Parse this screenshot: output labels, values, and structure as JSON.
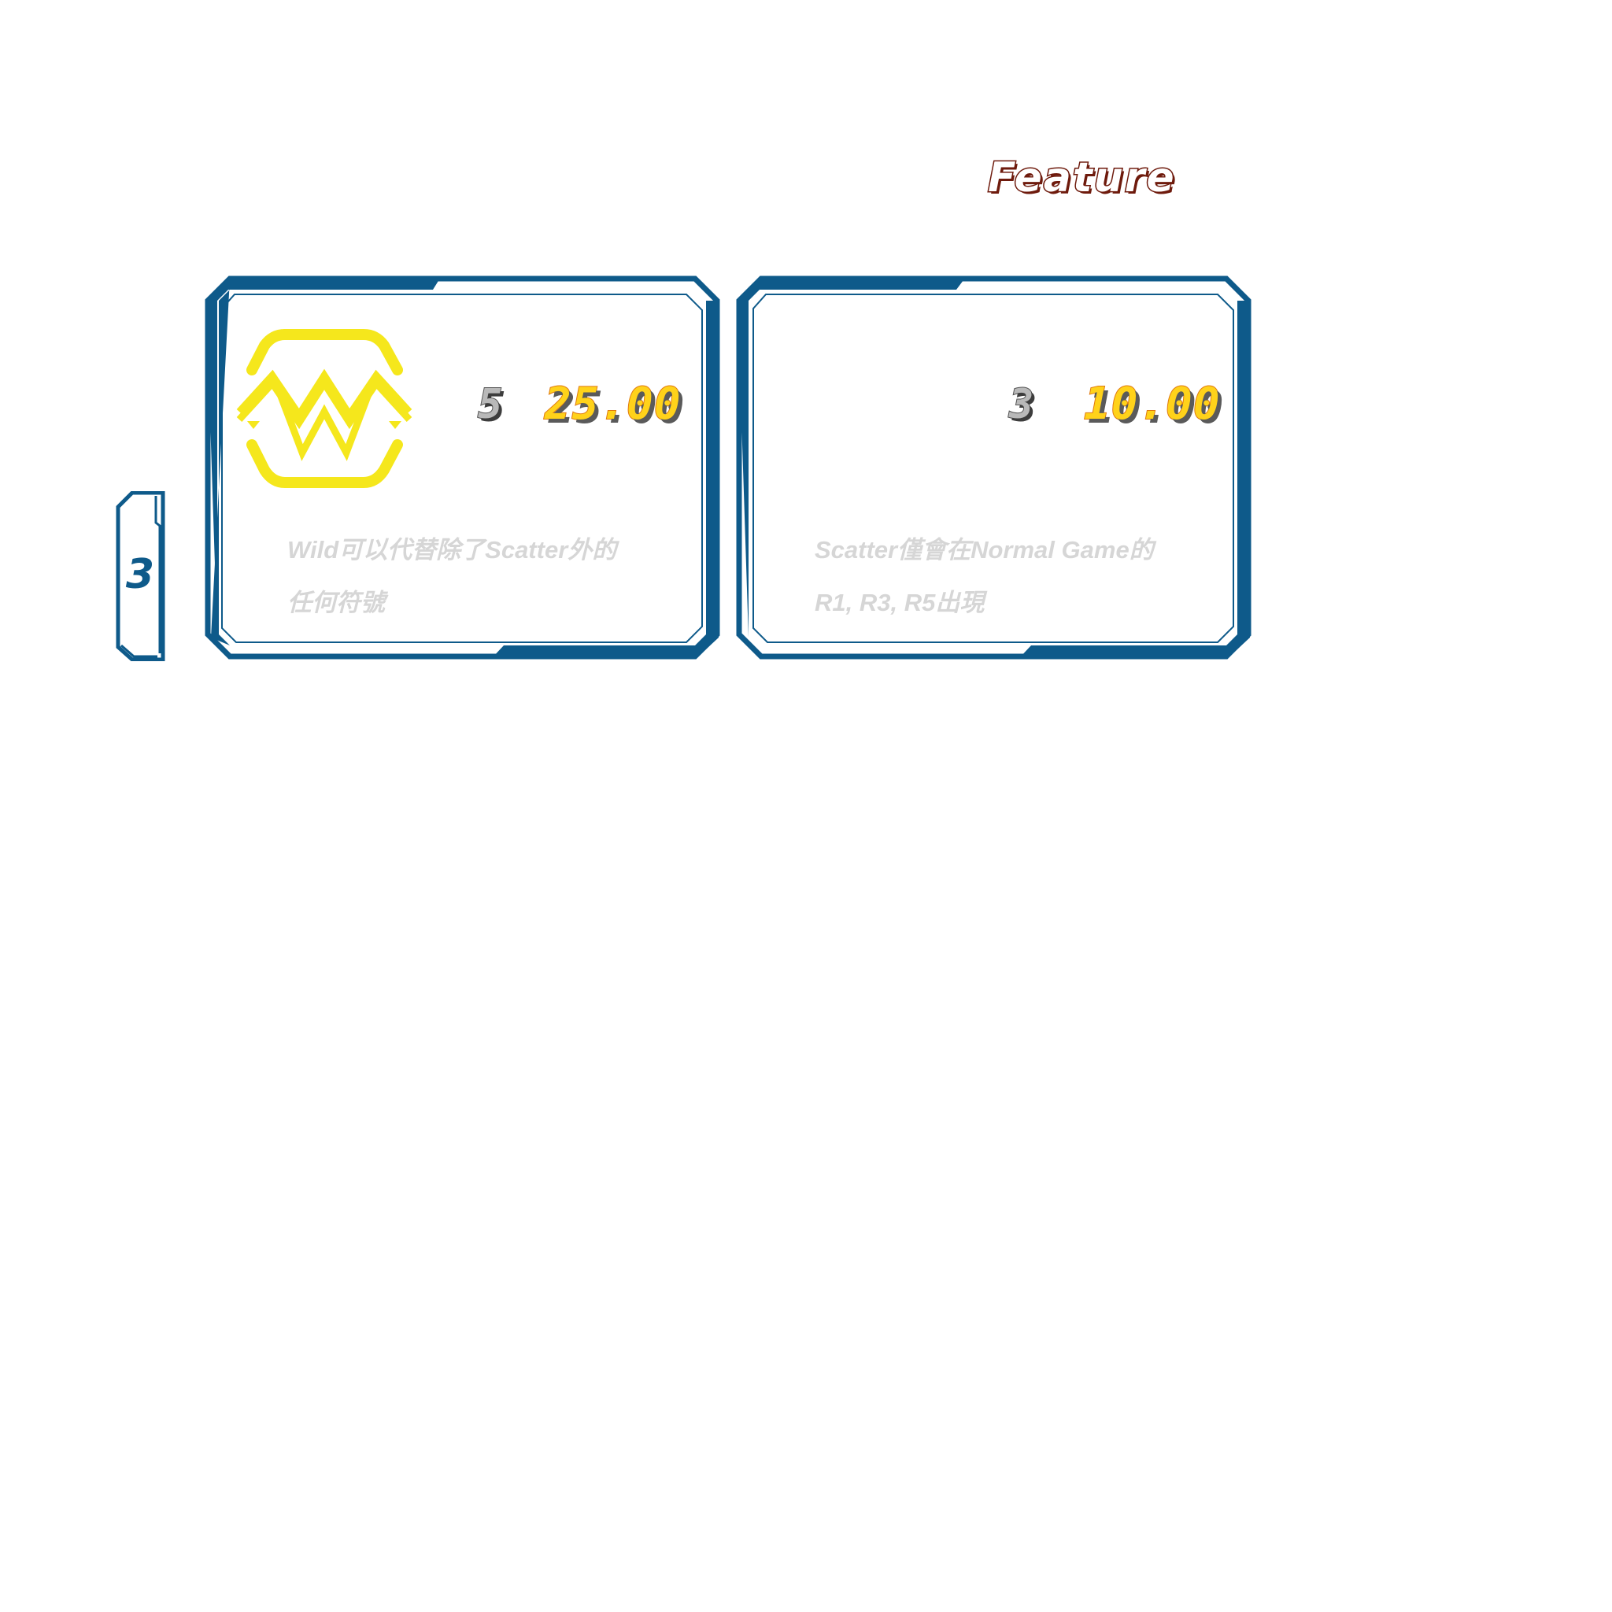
{
  "header": {
    "title": "Feature"
  },
  "side_tab": {
    "label": "3"
  },
  "panels": [
    {
      "symbol": "wild-icon",
      "count": "5",
      "payout": "25.00",
      "description_lines": [
        "Wild可以代替除了Scatter外的",
        "任何符號"
      ]
    },
    {
      "symbol": "",
      "count": "3",
      "payout": "10.00",
      "description_lines": [
        "Scatter僅會在Normal Game的",
        "R1, R3, R5出現"
      ]
    }
  ],
  "colors": {
    "frame_blue": "#0e5a8a",
    "title_outline": "#6e1a0c",
    "payout_yellow": "#ffd21a",
    "wild_yellow": "#f5e71c",
    "description_gray": "#d6d6d6"
  }
}
